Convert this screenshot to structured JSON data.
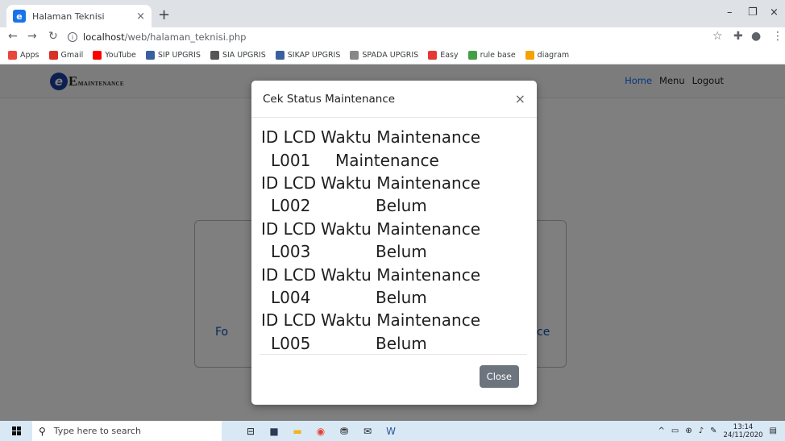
{
  "browser": {
    "tab_title": "Halaman Teknisi",
    "tab_close": "×",
    "new_tab": "+",
    "win_min": "–",
    "win_max": "❐",
    "win_close": "×",
    "url_host": "localhost",
    "url_path": "/web/halaman_teknisi.php",
    "bookmarks": [
      {
        "label": "Apps",
        "color": "#e8453c"
      },
      {
        "label": "Gmail",
        "color": "#d93025"
      },
      {
        "label": "YouTube",
        "color": "#ff0000"
      },
      {
        "label": "SIP UPGRIS",
        "color": "#3a5f9e"
      },
      {
        "label": "SIA UPGRIS",
        "color": "#555555"
      },
      {
        "label": "SIKAP UPGRIS",
        "color": "#3a5f9e"
      },
      {
        "label": "SPADA UPGRIS",
        "color": "#888888"
      },
      {
        "label": "Easy",
        "color": "#e53935"
      },
      {
        "label": "rule base",
        "color": "#43a047"
      },
      {
        "label": "diagram",
        "color": "#f4a300"
      }
    ]
  },
  "page": {
    "logo_letter": "e",
    "logo_text": "E",
    "logo_small": "MAINTENANCE",
    "nav": {
      "home": "Home",
      "menu": "Menu",
      "logout": "Logout"
    },
    "card_link_left": "Fo",
    "card_link_right": "ce"
  },
  "modal": {
    "title": "Cek Status Maintenance",
    "close_x": "×",
    "header_id": "ID LCD",
    "header_time": "Waktu Maintenance",
    "rows": [
      {
        "id": "L001",
        "status": "Maintenance"
      },
      {
        "id": "L002",
        "status": "Belum"
      },
      {
        "id": "L003",
        "status": "Belum"
      },
      {
        "id": "L004",
        "status": "Belum"
      },
      {
        "id": "L005",
        "status": "Belum"
      }
    ],
    "close_button": "Close"
  },
  "taskbar": {
    "search_placeholder": "Type here to search",
    "time": "13:14",
    "date": "24/11/2020"
  }
}
